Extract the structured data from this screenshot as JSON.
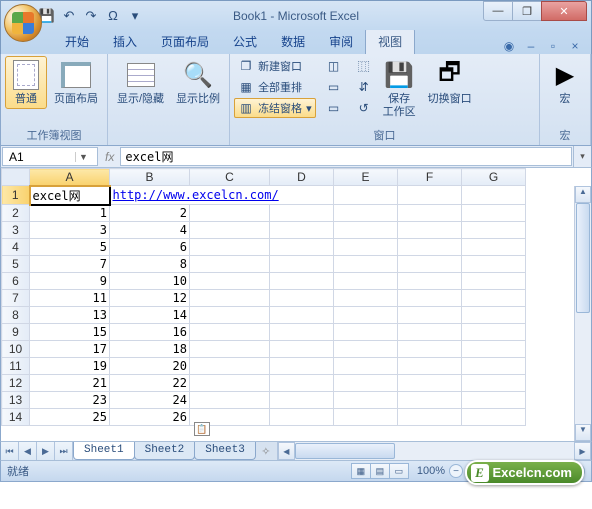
{
  "title": "Book1 - Microsoft Excel",
  "qat": {
    "save": "💾",
    "undo": "↶",
    "redo": "↷",
    "omega": "Ω"
  },
  "win": {
    "min": "—",
    "max": "❐",
    "close": "✕"
  },
  "tabs": [
    "开始",
    "插入",
    "页面布局",
    "公式",
    "数据",
    "审阅",
    "视图"
  ],
  "active_tab": 6,
  "ribbon": {
    "g1": {
      "label": "工作簿视图",
      "normal": "普通",
      "page_layout": "页面布局"
    },
    "g2": {
      "show_hide": "显示/隐藏",
      "zoom": "显示比例"
    },
    "g3": {
      "label": "窗口",
      "new_window": "新建窗口",
      "arrange_all": "全部重排",
      "freeze": "冻结窗格",
      "save_workspace": "保存\n工作区",
      "switch_win": "切换窗口"
    },
    "g4": {
      "label": "宏",
      "macro": "宏"
    }
  },
  "namebox": "A1",
  "formula": "excel网",
  "columns": [
    "A",
    "B",
    "C",
    "D",
    "E",
    "F",
    "G"
  ],
  "link_url": "http://www.excelcn.com/",
  "rows": [
    {
      "n": 1,
      "a": "excel网",
      "b_link": true
    },
    {
      "n": 2,
      "a": "1",
      "b": "2"
    },
    {
      "n": 3,
      "a": "3",
      "b": "4"
    },
    {
      "n": 4,
      "a": "5",
      "b": "6"
    },
    {
      "n": 5,
      "a": "7",
      "b": "8"
    },
    {
      "n": 6,
      "a": "9",
      "b": "10"
    },
    {
      "n": 7,
      "a": "11",
      "b": "12"
    },
    {
      "n": 8,
      "a": "13",
      "b": "14"
    },
    {
      "n": 9,
      "a": "15",
      "b": "16"
    },
    {
      "n": 10,
      "a": "17",
      "b": "18"
    },
    {
      "n": 11,
      "a": "19",
      "b": "20"
    },
    {
      "n": 12,
      "a": "21",
      "b": "22"
    },
    {
      "n": 13,
      "a": "23",
      "b": "24"
    },
    {
      "n": 14,
      "a": "25",
      "b": "26"
    }
  ],
  "sheets": [
    "Sheet1",
    "Sheet2",
    "Sheet3"
  ],
  "status": "就绪",
  "zoom_pct": "100%",
  "watermark": "Excelcn.com"
}
